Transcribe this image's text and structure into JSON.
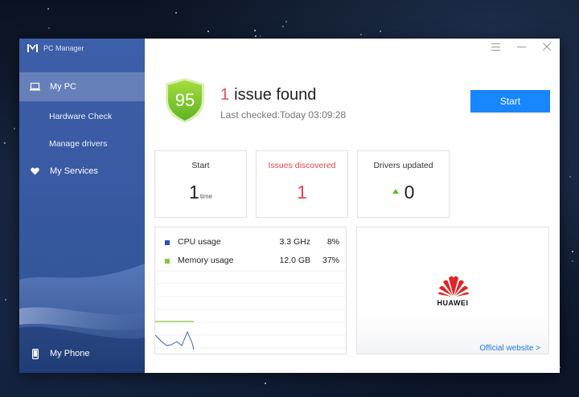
{
  "app": {
    "title": "PC Manager"
  },
  "sidebar": {
    "items": [
      {
        "label": "My PC",
        "icon": "laptop-icon",
        "active": true
      },
      {
        "label": "Hardware Check",
        "sub": true
      },
      {
        "label": "Manage drivers",
        "sub": true
      },
      {
        "label": "My Services",
        "icon": "heart-icon"
      },
      {
        "label": "My Phone",
        "icon": "phone-icon"
      }
    ]
  },
  "status": {
    "score": "95",
    "issue_count": "1",
    "issue_text": "issue found",
    "last_checked": "Last checked:Today 03:09:28",
    "start_label": "Start"
  },
  "cards": [
    {
      "title": "Start",
      "value": "1",
      "unit": "time"
    },
    {
      "title": "Issues discovered",
      "value": "1"
    },
    {
      "title": "Drivers updated",
      "value": "0"
    }
  ],
  "usage": {
    "cpu": {
      "label": "CPU usage",
      "speed": "3.3 GHz",
      "percent": "8%",
      "color": "#2f4fb5"
    },
    "memory": {
      "label": "Memory usage",
      "size": "12.0 GB",
      "percent": "37%",
      "color": "#8cc63f"
    }
  },
  "brand": {
    "name": "HUAWEI",
    "link_label": "Official website >",
    "logo_color": "#e02425"
  },
  "colors": {
    "accent": "#1786ff",
    "danger": "#e0474c",
    "shield": "#7cc62e"
  }
}
